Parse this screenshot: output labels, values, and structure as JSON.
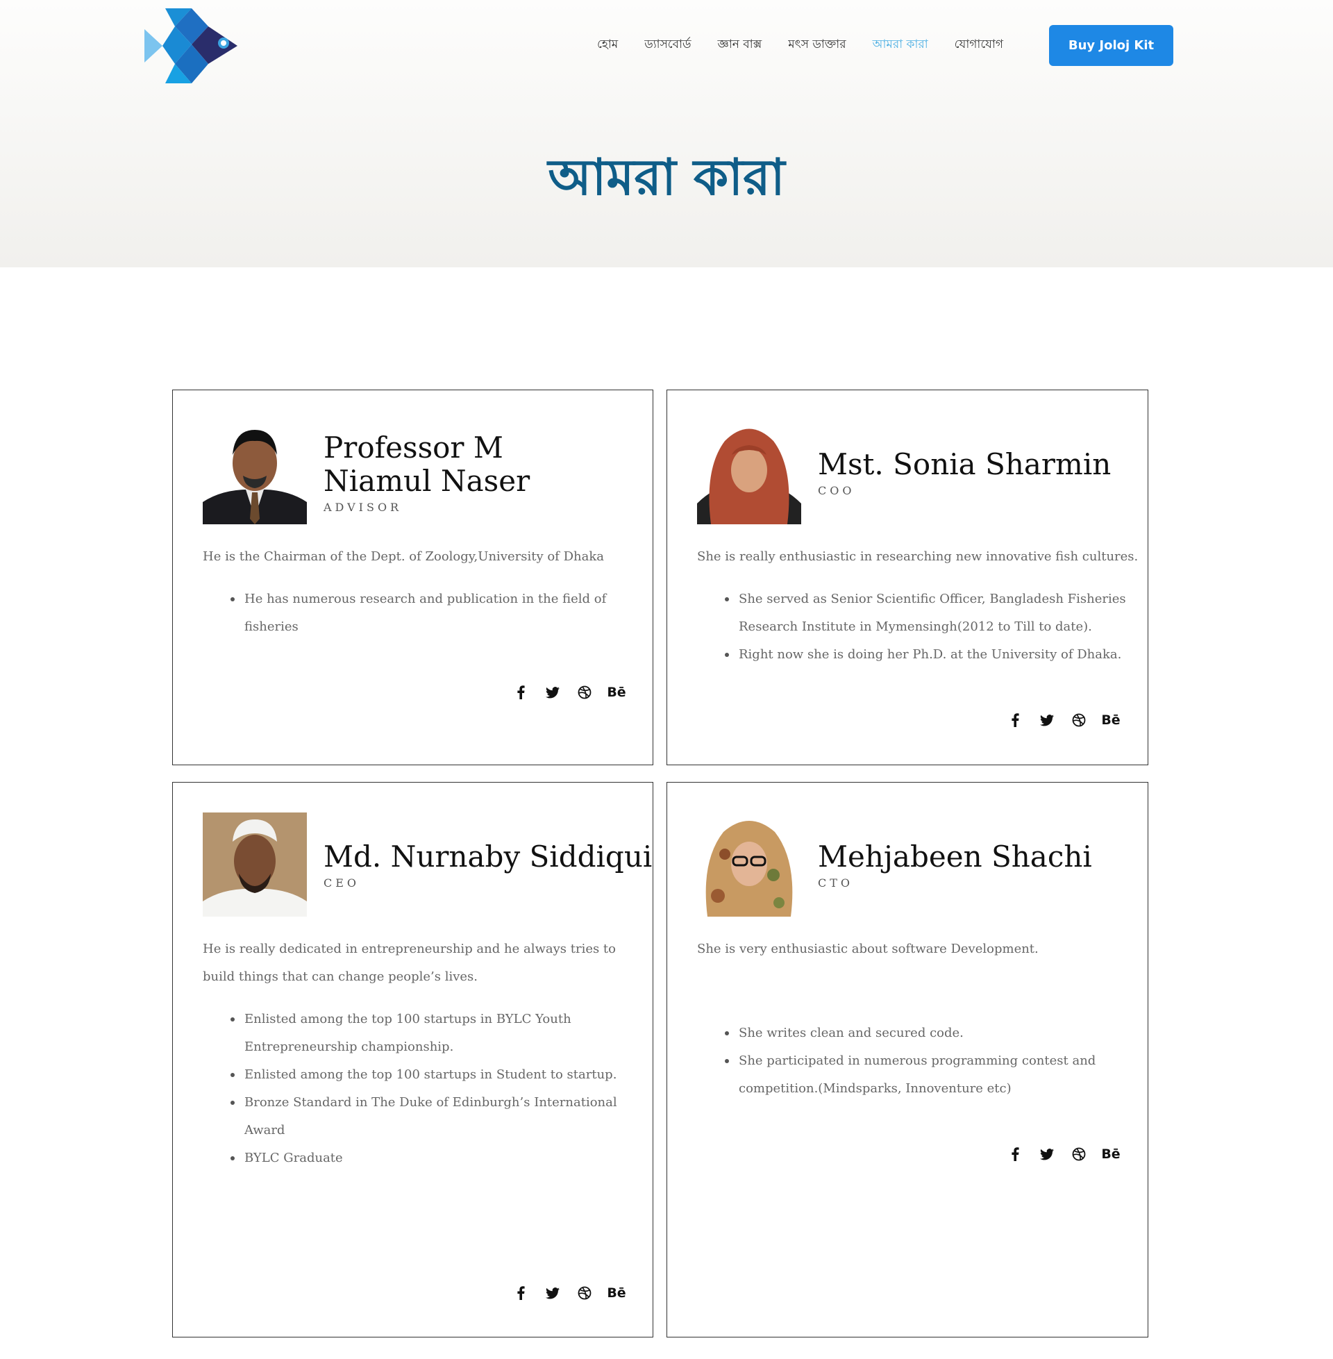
{
  "nav": {
    "items": [
      {
        "label": "হোম",
        "active": false
      },
      {
        "label": "ড্যাসবোর্ড",
        "active": false
      },
      {
        "label": "জ্ঞান বাক্স",
        "active": false
      },
      {
        "label": "মৎস ডাক্তার",
        "active": false
      },
      {
        "label": "আমরা কারা",
        "active": true
      },
      {
        "label": "যোগাযোগ",
        "active": false
      }
    ],
    "buy_label": "Buy Joloj Kit"
  },
  "page": {
    "title": "আমরা কারা"
  },
  "colors": {
    "accent": "#1e88e5",
    "title": "#0f5d88",
    "active_nav": "#4aaee3"
  },
  "team": [
    {
      "name": "Professor M Niamul Naser",
      "role": "ADVISOR",
      "description": "He is the Chairman of the Dept. of Zoology,University of Dhaka",
      "bullets": [
        "He has numerous research and publication in the field of",
        "fisheries"
      ],
      "socials": [
        "facebook-icon",
        "twitter-icon",
        "dribbble-icon",
        "behance-icon"
      ]
    },
    {
      "name": "Mst. Sonia Sharmin",
      "role": "COO",
      "description": "She is really enthusiastic in researching new innovative fish cultures.",
      "bullets": [
        "She served as Senior Scientific Officer, Bangladesh Fisheries",
        "Research Institute in Mymensingh(2012 to Till to date).",
        "Right now she is doing her Ph.D. at the University of Dhaka."
      ],
      "socials": [
        "facebook-icon",
        "twitter-icon",
        "dribbble-icon",
        "behance-icon"
      ]
    },
    {
      "name": "Md. Nurnaby Siddiqui",
      "role": "CEO",
      "description_lines": [
        "He is really dedicated in entrepreneurship and he always tries to",
        "build things that can change people’s lives."
      ],
      "bullets": [
        "Enlisted among the top 100 startups in BYLC Youth",
        "Entrepreneurship championship.",
        "Enlisted among the top 100 startups in Student to startup.",
        "Bronze Standard in The Duke of Edinburgh’s International",
        "Award",
        "BYLC Graduate"
      ],
      "socials": [
        "facebook-icon",
        "twitter-icon",
        "dribbble-icon",
        "behance-icon"
      ]
    },
    {
      "name": "Mehjabeen Shachi",
      "role": "CTO",
      "description": "She is very enthusiastic about software Development.",
      "bullets": [
        "She writes clean and secured code.",
        "She participated in numerous programming contest and",
        "competition.(Mindsparks, Innoventure etc)"
      ],
      "socials": [
        "facebook-icon",
        "twitter-icon",
        "dribbble-icon",
        "behance-icon"
      ]
    }
  ],
  "social_glyphs": {
    "behance": "Bē"
  }
}
